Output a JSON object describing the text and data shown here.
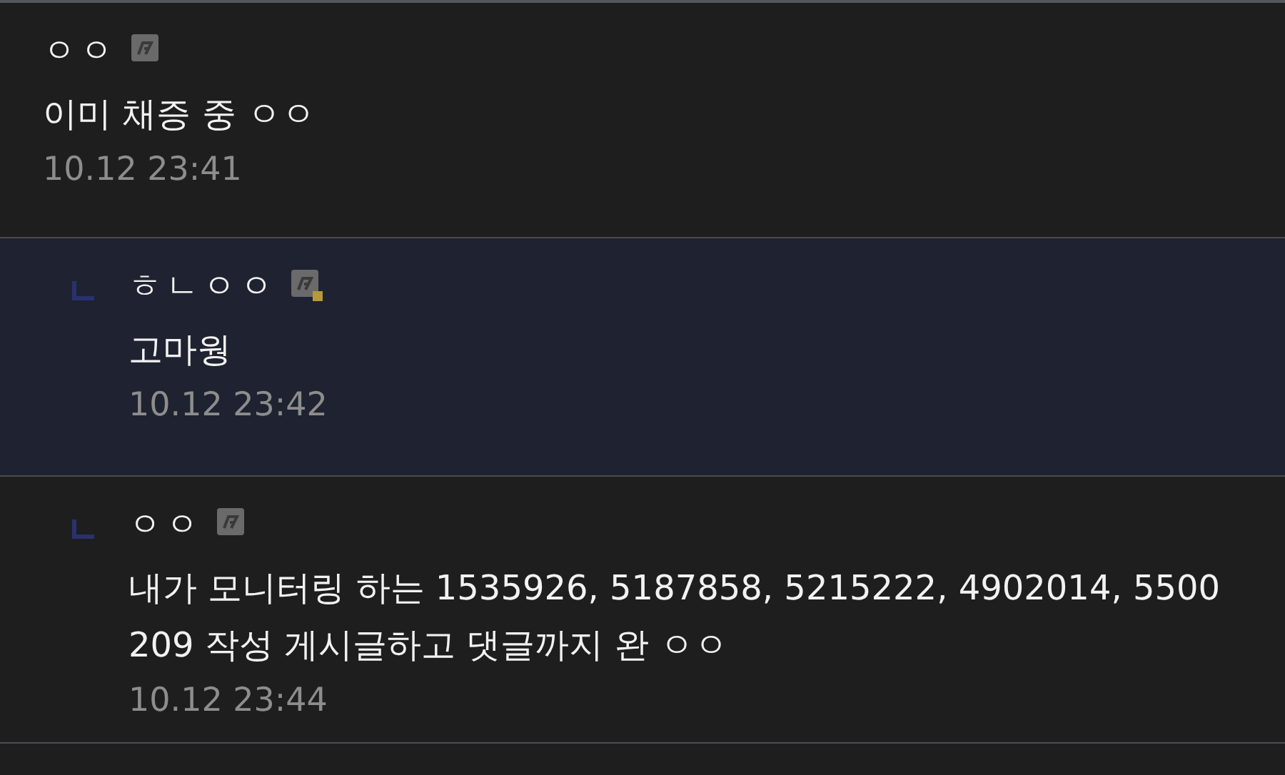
{
  "comments": [
    {
      "kind": "comment",
      "nickname": "ㅇㅇ",
      "badge_dot": false,
      "highlighted": false,
      "text": "이미 채증 중 ㅇㅇ",
      "time": "10.12 23:41"
    },
    {
      "kind": "reply",
      "nickname": "ㅎㄴㅇㅇ",
      "badge_dot": true,
      "highlighted": true,
      "text": "고마웡",
      "time": "10.12 23:42"
    },
    {
      "kind": "reply",
      "nickname": "ㅇㅇ",
      "badge_dot": false,
      "highlighted": false,
      "text": "내가 모니터링 하는 1535926, 5187858, 5215222, 4902014, 5500209 작성 게시글하고 댓글까지 완 ㅇㅇ",
      "time": "10.12 23:44"
    }
  ]
}
